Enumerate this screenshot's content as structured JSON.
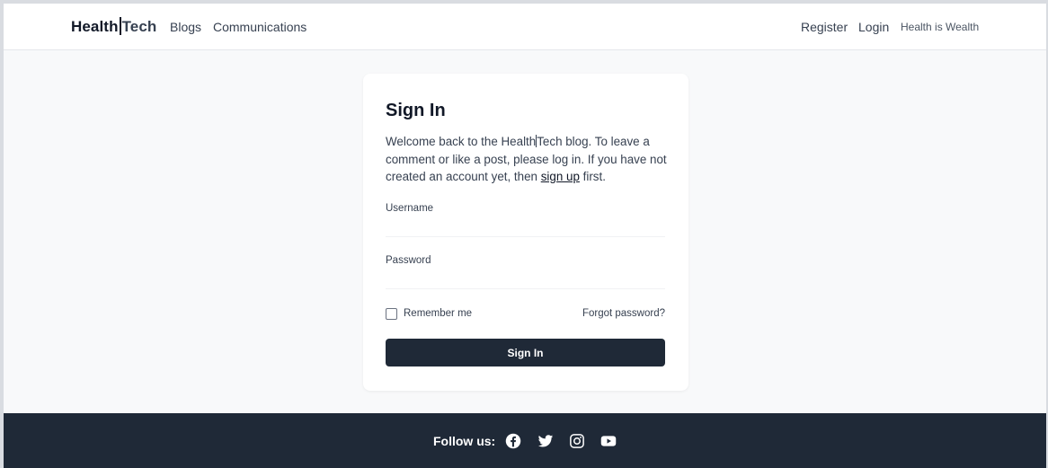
{
  "navbar": {
    "brand_left": "Health",
    "brand_right": "Tech",
    "links": [
      "Blogs",
      "Communications"
    ],
    "register": "Register",
    "login": "Login",
    "tagline": "Health is Wealth"
  },
  "signin": {
    "title": "Sign In",
    "desc_part1": "Welcome back to the Health",
    "desc_part2": "Tech blog. To leave a comment or like a post, please log in. If you have not created an account yet, then ",
    "signup_link": "sign up",
    "desc_part3": " first.",
    "username_label": "Username",
    "username_value": "",
    "password_label": "Password",
    "password_value": "",
    "remember_label": "Remember me",
    "remember_checked": false,
    "forgot_label": "Forgot password?",
    "submit_label": "Sign In"
  },
  "footer": {
    "follow_label": "Follow us:",
    "social_icons": [
      "facebook-icon",
      "twitter-icon",
      "instagram-icon",
      "youtube-icon"
    ]
  },
  "colors": {
    "primary_dark": "#1f2937",
    "background": "#f8f9fa",
    "text": "#374151"
  }
}
